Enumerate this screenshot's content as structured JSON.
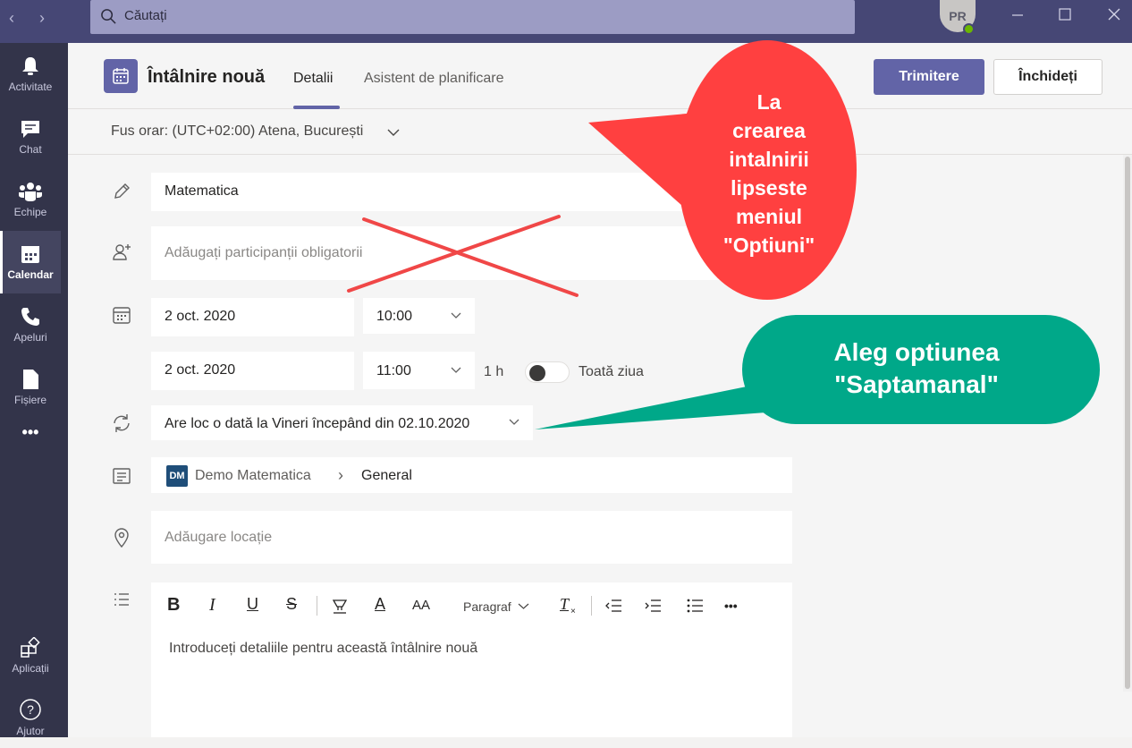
{
  "titlebar": {
    "search_placeholder": "Căutați",
    "avatar_initials": "PR"
  },
  "rail": {
    "items": [
      {
        "label": "Activitate",
        "icon": "bell-icon"
      },
      {
        "label": "Chat",
        "icon": "chat-icon"
      },
      {
        "label": "Echipe",
        "icon": "teams-icon"
      },
      {
        "label": "Calendar",
        "icon": "calendar-icon"
      },
      {
        "label": "Apeluri",
        "icon": "phone-icon"
      },
      {
        "label": "Fișiere",
        "icon": "file-icon"
      },
      {
        "label": "Aplicații",
        "icon": "apps-icon"
      },
      {
        "label": "Ajutor",
        "icon": "help-icon"
      }
    ],
    "more": "•••",
    "active": "Calendar"
  },
  "header": {
    "title": "Întâlnire nouă",
    "tabs": [
      "Detalii",
      "Asistent de planificare"
    ],
    "send_label": "Trimitere",
    "close_label": "Închideți"
  },
  "form": {
    "timezone": "Fus orar: (UTC+02:00) Atena, București",
    "title_value": "Matematica",
    "attendees_placeholder": "Adăugați participanții obligatorii",
    "start_date": "2 oct. 2020",
    "start_time": "10:00",
    "end_date": "2 oct. 2020",
    "end_time": "11:00",
    "duration": "1 h",
    "all_day_label": "Toată ziua",
    "all_day": false,
    "recurrence": "Are loc o dată la Vineri începând din 02.10.2020",
    "channel_badge": "DM",
    "channel_team": "Demo Matematica",
    "channel_separator": "›",
    "channel_name": "General",
    "location_placeholder": "Adăugare locație",
    "toolbar": {
      "bold": "B",
      "italic": "I",
      "underline": "U",
      "strike": "S",
      "font_color": "A",
      "font_size": "AA",
      "paragraph": "Paragraf",
      "clear_format": "T",
      "more": "•••"
    },
    "details_placeholder": "Introduceți detaliile pentru această întâlnire nouă"
  },
  "annotations": {
    "red_callout": [
      "La",
      "crearea",
      "intalnirii",
      "lipseste",
      "meniul",
      "\"Optiuni\""
    ],
    "green_callout": [
      "Aleg optiunea",
      "\"Saptamanal\""
    ],
    "red_color": "#ff4040",
    "green_color": "#00a889"
  },
  "colors": {
    "accent": "#6264a7",
    "titlebar": "#464775",
    "rail": "#33344a"
  }
}
